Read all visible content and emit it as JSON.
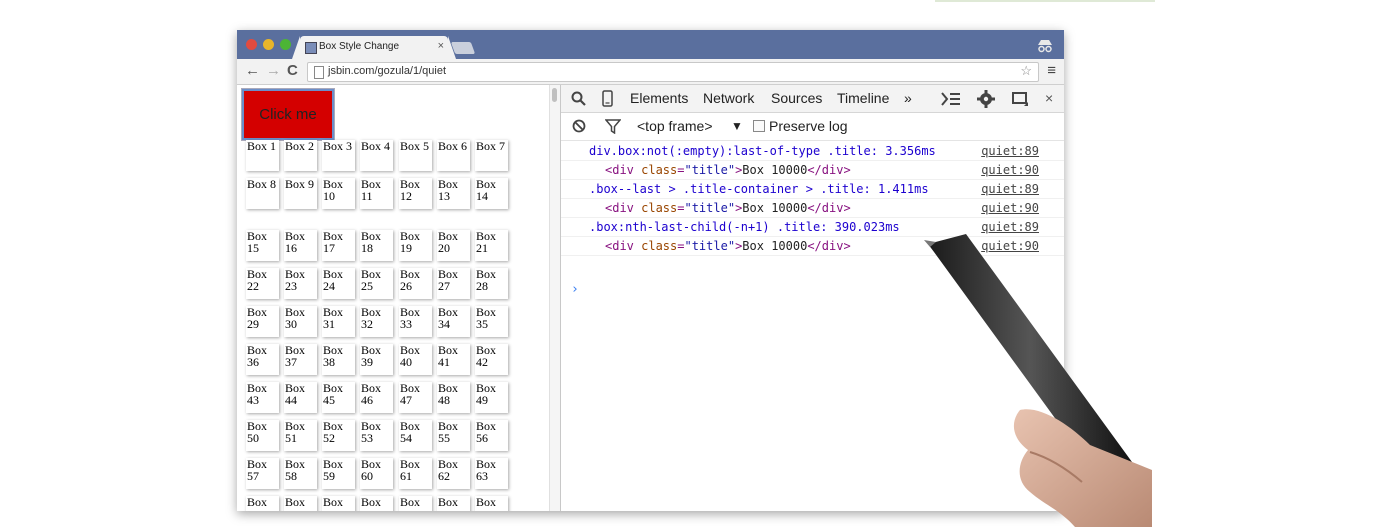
{
  "browser": {
    "tab_title": "Box Style Change",
    "tab_close": "×",
    "url": "jsbin.com/gozula/1/quiet",
    "back": "←",
    "forward": "→",
    "reload": "C",
    "star": "☆",
    "menu": "≡"
  },
  "page": {
    "button_label": "Click me",
    "boxes": [
      [
        "Box 1",
        "Box 2",
        "Box 3",
        "Box 4",
        "Box 5",
        "Box 6",
        "Box 7"
      ],
      [
        "Box 8",
        "Box 9",
        "Box 10",
        "Box 11",
        "Box 12",
        "Box 13",
        "Box 14"
      ],
      [
        "Box 15",
        "Box 16",
        "Box 17",
        "Box 18",
        "Box 19",
        "Box 20",
        "Box 21"
      ],
      [
        "Box 22",
        "Box 23",
        "Box 24",
        "Box 25",
        "Box 26",
        "Box 27",
        "Box 28"
      ],
      [
        "Box 29",
        "Box 30",
        "Box 31",
        "Box 32",
        "Box 33",
        "Box 34",
        "Box 35"
      ],
      [
        "Box 36",
        "Box 37",
        "Box 38",
        "Box 39",
        "Box 40",
        "Box 41",
        "Box 42"
      ],
      [
        "Box 43",
        "Box 44",
        "Box 45",
        "Box 46",
        "Box 47",
        "Box 48",
        "Box 49"
      ],
      [
        "Box 50",
        "Box 51",
        "Box 52",
        "Box 53",
        "Box 54",
        "Box 55",
        "Box 56"
      ],
      [
        "Box 57",
        "Box 58",
        "Box 59",
        "Box 60",
        "Box 61",
        "Box 62",
        "Box 63"
      ],
      [
        "Box",
        "Box",
        "Box",
        "Box",
        "Box",
        "Box",
        "Box"
      ]
    ]
  },
  "devtools": {
    "tabs": [
      "Elements",
      "Network",
      "Sources",
      "Timeline"
    ],
    "more": "»",
    "close": "×",
    "frame_selector": "<top frame>",
    "frame_arrow": "▼",
    "preserve_log": "Preserve log",
    "console": [
      {
        "kind": "selector",
        "text": "div.box:not(:empty):last-of-type .title: 3.356ms",
        "source": "quiet:89"
      },
      {
        "kind": "html",
        "tag_open": "<div ",
        "attr": "class",
        "eq": "=",
        "val": "\"title\"",
        "close": ">",
        "text": "Box 10000",
        "tag_end": "</div>",
        "source": "quiet:90"
      },
      {
        "kind": "selector",
        "text": ".box--last > .title-container > .title: 1.411ms",
        "source": "quiet:89"
      },
      {
        "kind": "html",
        "tag_open": "<div ",
        "attr": "class",
        "eq": "=",
        "val": "\"title\"",
        "close": ">",
        "text": "Box 10000",
        "tag_end": "</div>",
        "source": "quiet:90"
      },
      {
        "kind": "selector",
        "text": ".box:nth-last-child(-n+1) .title: 390.023ms",
        "source": "quiet:89"
      },
      {
        "kind": "html",
        "tag_open": "<div ",
        "attr": "class",
        "eq": "=",
        "val": "\"title\"",
        "close": ">",
        "text": "Box 10000",
        "tag_end": "</div>",
        "source": "quiet:90"
      }
    ],
    "prompt": "›"
  }
}
